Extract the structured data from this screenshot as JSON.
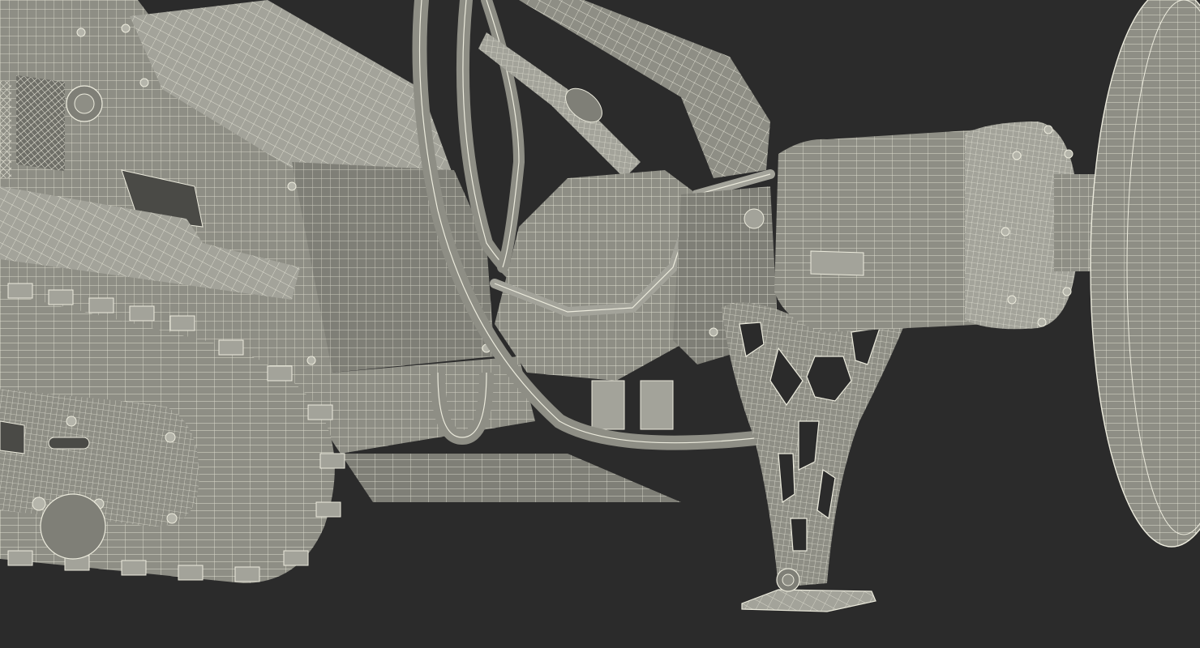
{
  "scene": {
    "subject": "wireframe-render",
    "colors": {
      "background": "#2b2b2b",
      "surface": "#8e8e85",
      "surface_light": "#a3a39a",
      "surface_dark": "#6f6f68",
      "wire": "#ecebdd"
    }
  }
}
